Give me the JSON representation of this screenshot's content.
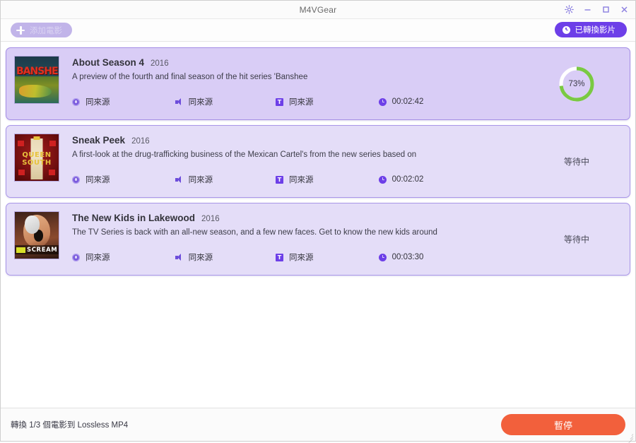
{
  "window": {
    "title": "M4VGear",
    "controls": [
      {
        "name": "settings-gear",
        "label": "⚙"
      },
      {
        "name": "minimize",
        "label": "–"
      },
      {
        "name": "maximize",
        "label": "□"
      },
      {
        "name": "close",
        "label": "×"
      }
    ]
  },
  "toolbar": {
    "add_movie_label": "添加電影",
    "add_movie_icon": "plus-icon",
    "converted_label": "已轉換影片",
    "converted_icon": "clock-icon"
  },
  "colors": {
    "accent_purple": "#6d3fe8",
    "card_bg": "#e4ddf8",
    "card_bg_active": "#d9cdf6",
    "card_border": "#a996e8",
    "progress_green": "#7ac943",
    "pause_red": "#f2603c"
  },
  "labels": {
    "same_as_source": "同來源",
    "waiting": "等待中",
    "video_icon": "video-icon",
    "audio_icon": "audio-icon",
    "subtitle_icon": "subtitle-icon",
    "subtitle_glyph": "T",
    "duration_icon": "clock-icon"
  },
  "movies": [
    {
      "title": "About Season 4",
      "year": "2016",
      "description": "A preview of the fourth and final season of the hit series 'Banshee",
      "poster": "banshee",
      "poster_text": "BANSHEE",
      "video": "同來源",
      "audio": "同來源",
      "subtitle": "同來源",
      "duration": "00:02:42",
      "state": "converting",
      "progress": 73,
      "progress_label": "73%"
    },
    {
      "title": "Sneak Peek",
      "year": "2016",
      "description": "A first-look at the drug-trafficking business of the Mexican Cartel's from the new series based on",
      "poster": "queen",
      "poster_text": "QUEEN OF THE SOUTH",
      "video": "同來源",
      "audio": "同來源",
      "subtitle": "同來源",
      "duration": "00:02:02",
      "state": "waiting",
      "status_label": "等待中"
    },
    {
      "title": "The New Kids in Lakewood",
      "year": "2016",
      "description": "The TV Series is back with an all-new season, and a few new faces. Get to know the new kids around",
      "poster": "scream",
      "poster_text": "SCREAM",
      "video": "同來源",
      "audio": "同來源",
      "subtitle": "同來源",
      "duration": "00:03:30",
      "state": "waiting",
      "status_label": "等待中"
    }
  ],
  "footer": {
    "status_text": "轉換 1/3 個電影到 Lossless MP4",
    "pause_label": "暫停"
  }
}
